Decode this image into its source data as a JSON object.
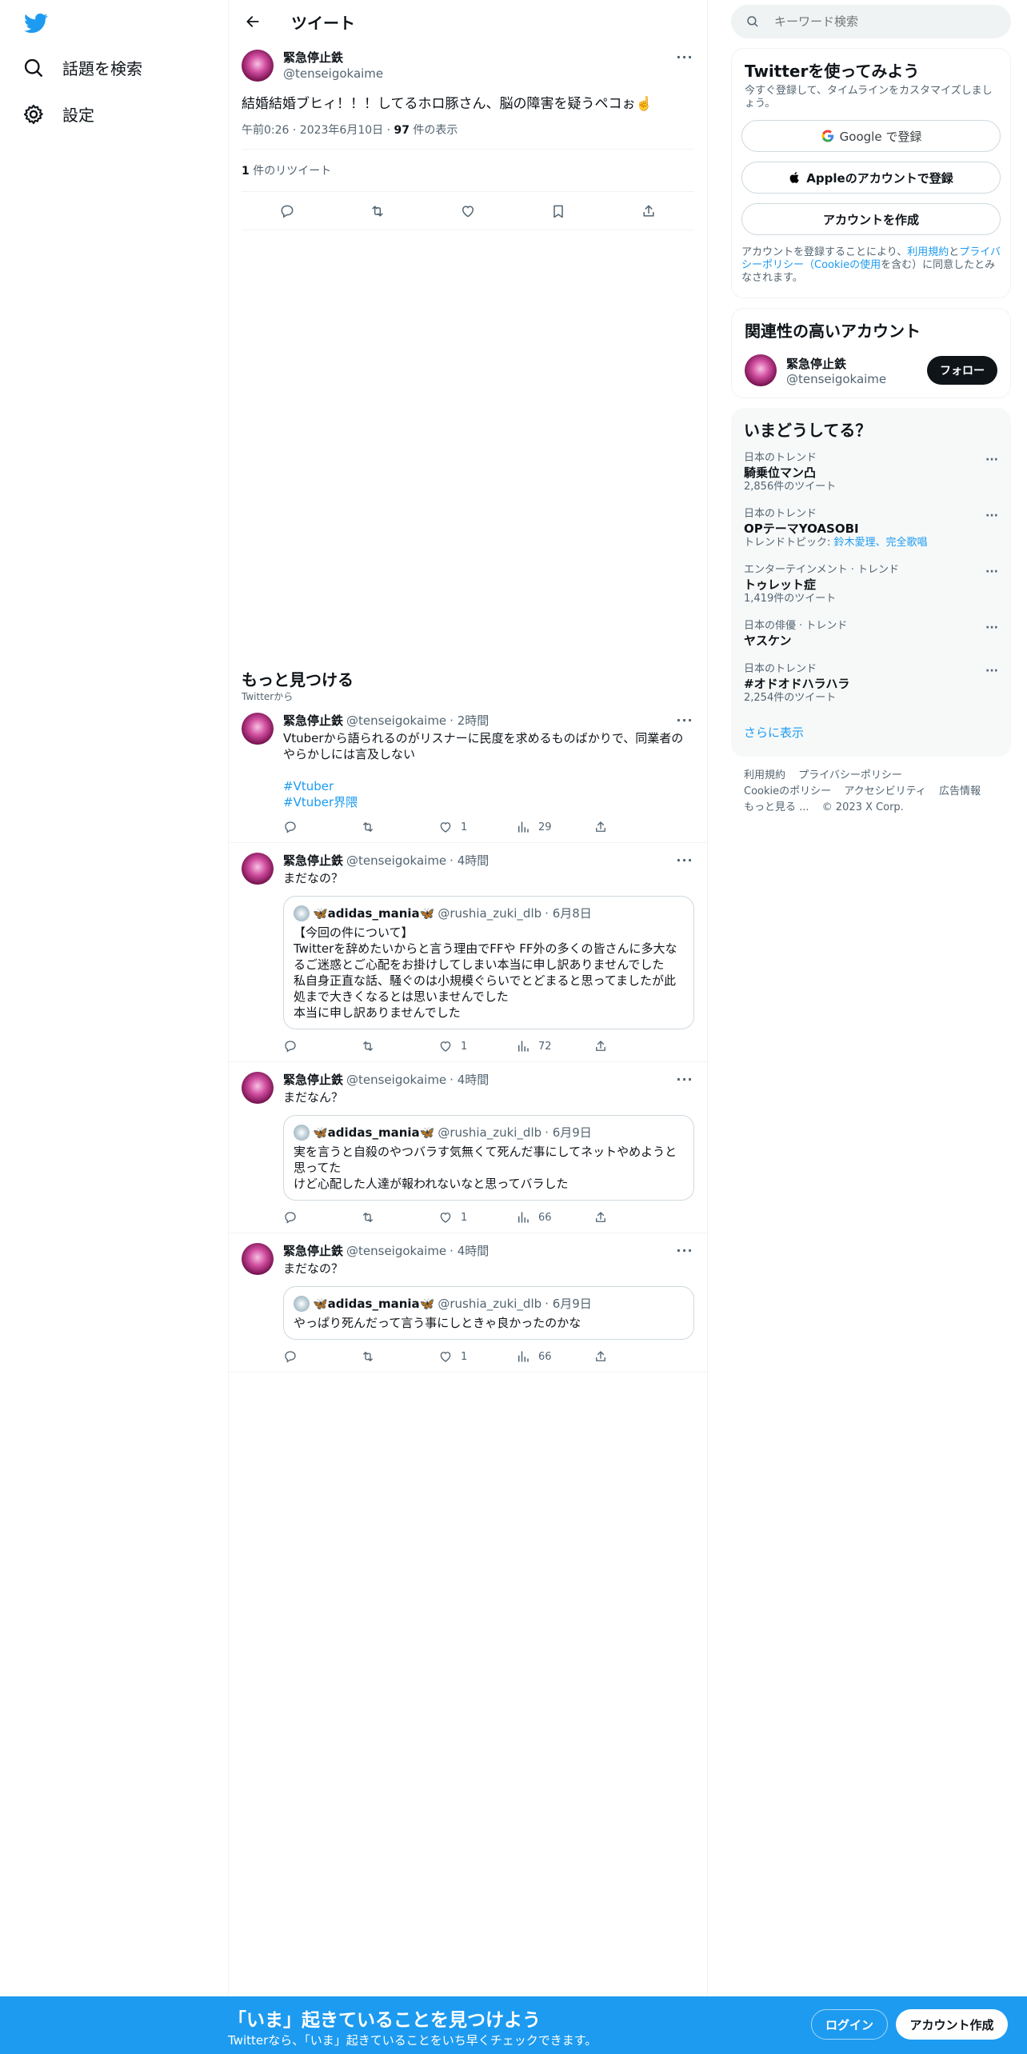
{
  "nav": {
    "explore": "話題を検索",
    "settings": "設定"
  },
  "header": {
    "title": "ツイート"
  },
  "main_tweet": {
    "name": "緊急停止鉄",
    "handle": "@tenseigokaime",
    "text": "結婚結婚ブヒィ！！！してるホロ豚さん、脳の障害を疑うペコぉ☝️",
    "time": "午前0:26 · 2023年6月10日 · ",
    "views": "97",
    "views_label": " 件の表示",
    "retweets": "1",
    "retweets_label": " 件のリツイート"
  },
  "discover": {
    "title": "もっと見つける",
    "sub": "Twitterから"
  },
  "tweets": [
    {
      "name": "緊急停止鉄",
      "handle": "@tenseigokaime",
      "time": "· 2時間",
      "text": "Vtuberから語られるのがリスナーに民度を求めるものばかりで、同業者のやらかしには言及しない",
      "hashtags": [
        "#Vtuber",
        "#Vtuber界隈"
      ],
      "likes": "1",
      "views": "29"
    },
    {
      "name": "緊急停止鉄",
      "handle": "@tenseigokaime",
      "time": "· 4時間",
      "text": "まだなの？",
      "quote": {
        "name": "🦋adidas_mania🦋",
        "handle": "@rushia_zuki_dlb",
        "time": "· 6月8日",
        "text": "【今回の件について】\nTwitterを辞めたいからと言う理由でFFや FF外の多くの皆さんに多大なるご迷惑とご心配をお掛けしてしまい本当に申し訳ありませんでした\n私自身正直な話、騒ぐのは小規模ぐらいでとどまると思ってましたが此処まで大きくなるとは思いませんでした\n本当に申し訳ありませんでした"
      },
      "likes": "1",
      "views": "72"
    },
    {
      "name": "緊急停止鉄",
      "handle": "@tenseigokaime",
      "time": "· 4時間",
      "text": "まだなん？",
      "quote": {
        "name": "🦋adidas_mania🦋",
        "handle": "@rushia_zuki_dlb",
        "time": "· 6月9日",
        "text": "実を言うと自殺のやつバラす気無くて死んだ事にしてネットやめようと思ってた\nけど心配した人達が報われないなと思ってバラした"
      },
      "likes": "1",
      "views": "66"
    },
    {
      "name": "緊急停止鉄",
      "handle": "@tenseigokaime",
      "time": "· 4時間",
      "text": "まだなの？",
      "quote": {
        "name": "🦋adidas_mania🦋",
        "handle": "@rushia_zuki_dlb",
        "time": "· 6月9日",
        "text": "やっぱり死んだって言う事にしときゃ良かったのかな"
      },
      "likes": "1",
      "views": "66"
    }
  ],
  "search": {
    "placeholder": "キーワード検索"
  },
  "signup": {
    "title": "Twitterを使ってみよう",
    "desc": "今すぐ登録して、タイムラインをカスタマイズしましょう。",
    "google": "Google で登録",
    "apple": "Appleのアカウントで登録",
    "create": "アカウントを作成",
    "terms_pre": "アカウントを登録することにより、",
    "terms_link1": "利用規約",
    "terms_mid": "と",
    "terms_link2": "プライバシーポリシー（Cookieの使用",
    "terms_post": "を含む）に同意したとみなされます。"
  },
  "related": {
    "title": "関連性の高いアカウント",
    "name": "緊急停止鉄",
    "handle": "@tenseigokaime",
    "follow": "フォロー"
  },
  "trends": {
    "title": "いまどうしてる？",
    "items": [
      {
        "cat": "日本のトレンド",
        "name": "騎乗位マン凸",
        "count": "2,856件のツイート"
      },
      {
        "cat": "日本のトレンド",
        "name": "OPテーマYOASOBI",
        "topic_label": "トレンドトピック: ",
        "topic": "鈴木愛理、完全歌唱"
      },
      {
        "cat": "エンターテインメント · トレンド",
        "name": "トゥレット症",
        "count": "1,419件のツイート"
      },
      {
        "cat": "日本の俳優 · トレンド",
        "name": "ヤスケン"
      },
      {
        "cat": "日本のトレンド",
        "name": "#オドオドハラハラ",
        "count": "2,254件のツイート"
      }
    ],
    "show_more": "さらに表示"
  },
  "footer": {
    "links1": [
      "利用規約",
      "プライバシーポリシー"
    ],
    "links2": [
      "Cookieのポリシー",
      "アクセシビリティ",
      "広告情報"
    ],
    "more": "もっと見る ...",
    "copyright": "© 2023 X Corp."
  },
  "bottom": {
    "title": "「いま」起きていることを見つけよう",
    "sub": "Twitterなら、「いま」起きていることをいち早くチェックできます。",
    "login": "ログイン",
    "signup": "アカウント作成"
  },
  "colors": {
    "accent": "#1d9bf0",
    "text": "#0f1419",
    "muted": "#536471"
  }
}
